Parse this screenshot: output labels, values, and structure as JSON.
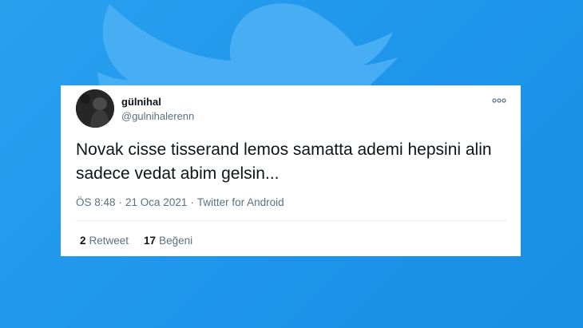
{
  "colors": {
    "background": "#1d95ea",
    "card": "#ffffff",
    "text": "#0f1419",
    "muted": "#5b7083"
  },
  "background_icon": "twitter-bird-icon",
  "tweet": {
    "display_name": "gülnihal",
    "handle": "@gulnihalerenn",
    "text": "Novak cisse tisserand lemos samatta ademi hepsini alin sadece vedat abim gelsin...",
    "time": "ÖS 8:48",
    "separator": "·",
    "date": "21 Oca 2021",
    "source": "Twitter for Android",
    "more_icon": "more-options-icon",
    "stats": {
      "retweet_count": "2",
      "retweet_label": "Retweet",
      "like_count": "17",
      "like_label": "Beğeni"
    }
  }
}
